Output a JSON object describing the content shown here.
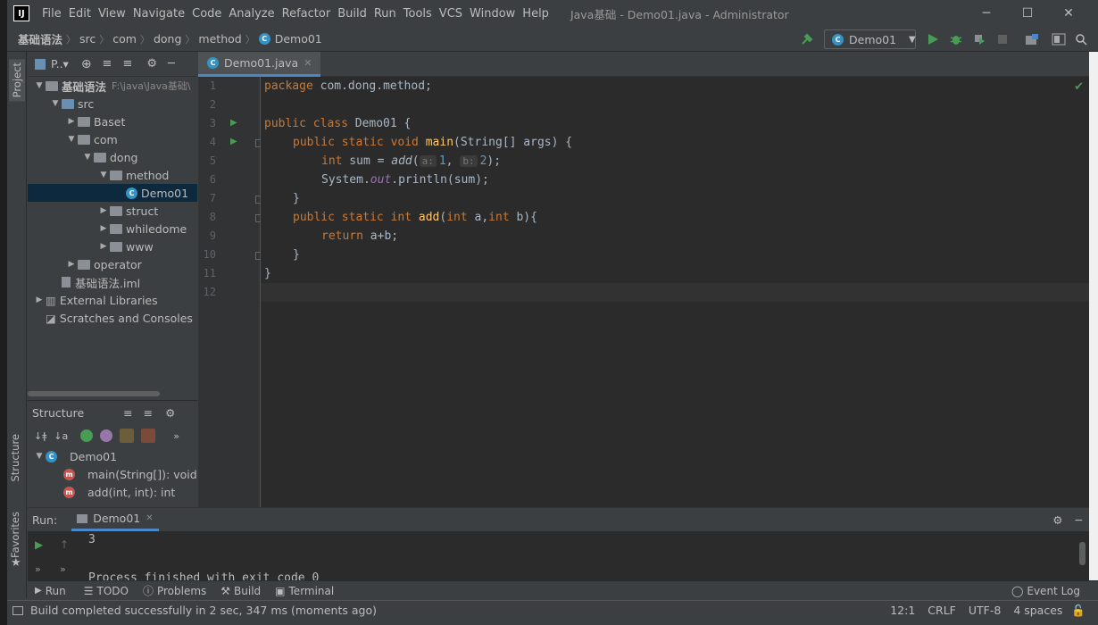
{
  "window": {
    "title": "Java基础 - Demo01.java - Administrator",
    "minimize_glyph": "─",
    "maximize_glyph": "☐",
    "close_glyph": "✕"
  },
  "menu": [
    "File",
    "Edit",
    "View",
    "Navigate",
    "Code",
    "Analyze",
    "Refactor",
    "Build",
    "Run",
    "Tools",
    "VCS",
    "Window",
    "Help"
  ],
  "breadcrumb": [
    "基础语法",
    "src",
    "com",
    "dong",
    "method",
    "Demo01"
  ],
  "run_config": {
    "label": "Demo01"
  },
  "colors": {
    "accent": "#4a88c7",
    "run_green": "#499c54",
    "selection": "#0d293e"
  },
  "project_panel": {
    "title": "P..▾",
    "tree": [
      {
        "label": "基础语法",
        "sub": "F:\\java\\Java基础\\",
        "level": 0,
        "expanded": true,
        "kind": "module"
      },
      {
        "label": "src",
        "level": 1,
        "expanded": true,
        "kind": "src"
      },
      {
        "label": "Baset",
        "level": 2,
        "expanded": false,
        "kind": "package"
      },
      {
        "label": "com",
        "level": 2,
        "expanded": true,
        "kind": "package"
      },
      {
        "label": "dong",
        "level": 3,
        "expanded": true,
        "kind": "package"
      },
      {
        "label": "method",
        "level": 4,
        "expanded": true,
        "kind": "package"
      },
      {
        "label": "Demo01",
        "level": 5,
        "kind": "class",
        "selected": true
      },
      {
        "label": "struct",
        "level": 4,
        "expanded": false,
        "kind": "package"
      },
      {
        "label": "whiledome",
        "level": 4,
        "expanded": false,
        "kind": "package"
      },
      {
        "label": "www",
        "level": 4,
        "expanded": false,
        "kind": "package"
      },
      {
        "label": "operator",
        "level": 2,
        "expanded": false,
        "kind": "package"
      },
      {
        "label": "基础语法.iml",
        "level": 1,
        "kind": "file"
      },
      {
        "label": "External Libraries",
        "level": 0,
        "expanded": false,
        "kind": "library"
      },
      {
        "label": "Scratches and Consoles",
        "level": 0,
        "kind": "scratch"
      }
    ]
  },
  "structure_panel": {
    "title": "Structure",
    "class_name": "Demo01",
    "members": [
      "main(String[]): void",
      "add(int, int): int"
    ]
  },
  "side_tabs": {
    "project": "Project",
    "structure": "Structure",
    "favorites": "Favorites"
  },
  "editor": {
    "tab": "Demo01.java",
    "line_numbers": [
      "1",
      "2",
      "3",
      "4",
      "5",
      "6",
      "7",
      "8",
      "9",
      "10",
      "11",
      "12"
    ],
    "code": {
      "l1_kw": "package",
      "l1_rest": " com.dong.method;",
      "l3_kw": "public class",
      "l3_rest": " Demo01 {",
      "l4_kw": "public static void",
      "l4_fn": "main",
      "l4_rest": "(String[] args) {",
      "l5_kw": "int",
      "l5_a": " sum = ",
      "l5_fn": "add",
      "l5_p": "(",
      "l5_h1": "a:",
      "l5_n1": "1",
      "l5_c": ", ",
      "l5_h2": "b:",
      "l5_n2": "2",
      "l5_e": ");",
      "l6_a": "System.",
      "l6_st": "out",
      "l6_b": ".println(sum);",
      "l7": "}",
      "l8_kw": "public static int",
      "l8_fn": "add",
      "l8_p": "(",
      "l8_kw2": "int",
      "l8_a": " a,",
      "l8_kw3": "int",
      "l8_b": " b){",
      "l9_kw": "return",
      "l9_rest": " a+b;",
      "l10": "}",
      "l11": "}"
    }
  },
  "run_panel": {
    "label": "Run:",
    "tab": "Demo01",
    "output_line1": "3",
    "output_line2": "Process finished with exit code 0"
  },
  "bottom_tabs": [
    "Run",
    "TODO",
    "Problems",
    "Build",
    "Terminal"
  ],
  "event_log": "Event Log",
  "status": {
    "message": "Build completed successfully in 2 sec, 347 ms (moments ago)",
    "position": "12:1",
    "line_sep": "CRLF",
    "encoding": "UTF-8",
    "indent": "4 spaces"
  }
}
